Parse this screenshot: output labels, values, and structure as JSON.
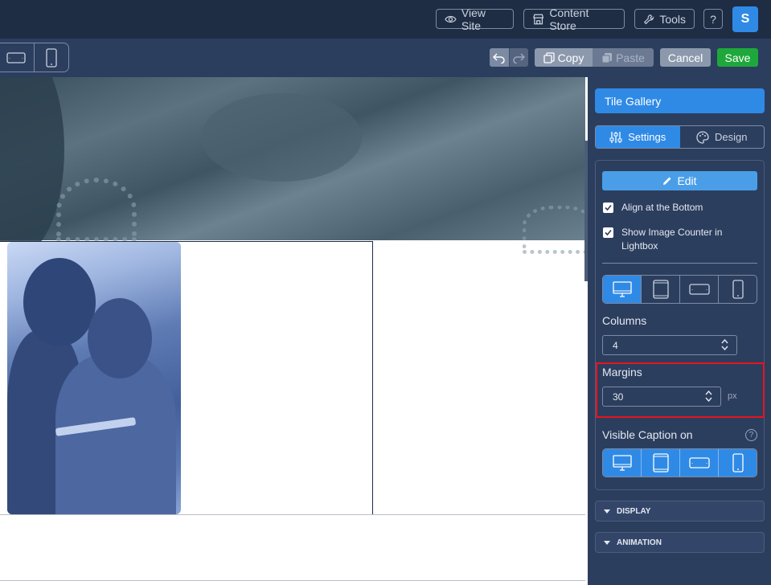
{
  "topbar": {
    "view_site": "View Site",
    "content_store": "Content Store",
    "tools": "Tools",
    "help": "?",
    "avatar": "S"
  },
  "toolbar": {
    "copy": "Copy",
    "paste": "Paste",
    "cancel": "Cancel",
    "save": "Save"
  },
  "panel": {
    "title": "Tile Gallery",
    "tabs": [
      {
        "label": "Settings",
        "icon": "sliders-icon",
        "active": true
      },
      {
        "label": "Design",
        "icon": "palette-icon",
        "active": false
      }
    ],
    "edit_label": "Edit",
    "checkboxes": [
      {
        "label": "Align at the Bottom",
        "checked": true
      },
      {
        "label": "Show Image Counter in Lightbox",
        "checked": true
      }
    ],
    "columns": {
      "label": "Columns",
      "value": "4"
    },
    "margins": {
      "label": "Margins",
      "value": "30",
      "unit": "px"
    },
    "visible_caption": {
      "label": "Visible Caption on",
      "help": "?"
    },
    "accordions": [
      {
        "label": "DISPLAY"
      },
      {
        "label": "ANIMATION"
      }
    ]
  },
  "colors": {
    "topbar": "#1f2d44",
    "toolbar": "#2c3e5e",
    "accent": "#2f8ae6",
    "save": "#1ea83b",
    "highlight": "#e8141e"
  }
}
